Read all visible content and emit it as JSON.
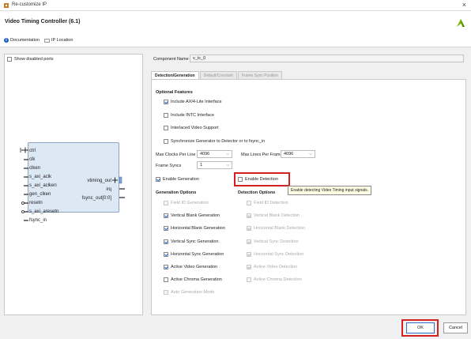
{
  "window": {
    "title": "Re-customize IP",
    "close_glyph": "×"
  },
  "header": {
    "title": "Video Timing Controller (6.1)",
    "links": [
      {
        "label": "Documentation",
        "icon": "info-icon"
      },
      {
        "label": "IP Location",
        "icon": "folder-icon"
      }
    ],
    "logo_color": "#7ab800"
  },
  "left_panel": {
    "show_disabled_ports_label": "Show disabled ports",
    "ports_left": [
      "ctrl",
      "clk",
      "clken",
      "s_axi_aclk",
      "s_axi_aclken",
      "gen_clken",
      "resetn",
      "s_axi_aresetn",
      "fsync_in"
    ],
    "ports_right": [
      "vtiming_out",
      "irq",
      "fsync_out[0:0]"
    ]
  },
  "component_name": {
    "label": "Component Name",
    "value": "v_tc_0"
  },
  "tabs": [
    "Detection/Generation",
    "Default/Constant",
    "Frame Sync Position"
  ],
  "optional_features": {
    "title": "Optional Features",
    "items": [
      {
        "label": "Include AXI4-Lite Interface",
        "checked": true
      },
      {
        "label": "Include INTC Interface",
        "checked": false
      },
      {
        "label": "Interlaced Video Support",
        "checked": false
      },
      {
        "label": "Synchronize Generator to Detector or to fsync_in",
        "checked": false
      }
    ]
  },
  "max_clocks": {
    "label": "Max Clocks Per Line",
    "value": "4096"
  },
  "max_lines": {
    "label": "Max Lines Per Frame",
    "value": "4096"
  },
  "frame_syncs": {
    "label": "Frame Syncs",
    "value": "1"
  },
  "enable_generation": {
    "label": "Enable Generation",
    "checked": true
  },
  "enable_detection": {
    "label": "Enable Detection",
    "checked": false
  },
  "tooltip": "Enable detecting Video Timing input signals.",
  "generation_options": {
    "title": "Generation Options",
    "items": [
      {
        "label": "Field ID Generation",
        "checked": false,
        "disabled": true
      },
      {
        "label": "Vertical Blank Generation",
        "checked": true,
        "disabled": false
      },
      {
        "label": "Horizontal Blank Generation",
        "checked": true,
        "disabled": false
      },
      {
        "label": "Vertical Sync Generation",
        "checked": true,
        "disabled": false
      },
      {
        "label": "Horizontal Sync Generation",
        "checked": true,
        "disabled": false
      },
      {
        "label": "Active Video Generation",
        "checked": true,
        "disabled": false
      },
      {
        "label": "Active Chroma Generation",
        "checked": false,
        "disabled": false
      },
      {
        "label": "Auto Generation Mode",
        "checked": false,
        "disabled": true
      }
    ]
  },
  "detection_options": {
    "title": "Detection Options",
    "items": [
      {
        "label": "Field ID Detection",
        "checked": false,
        "disabled": true
      },
      {
        "label": "Vertical Blank Detection",
        "checked": true,
        "disabled": true
      },
      {
        "label": "Horizontal Blank Detection",
        "checked": true,
        "disabled": true
      },
      {
        "label": "Vertical Sync Detection",
        "checked": true,
        "disabled": true
      },
      {
        "label": "Horizontal Sync Detection",
        "checked": true,
        "disabled": true
      },
      {
        "label": "Active Video Detection",
        "checked": true,
        "disabled": true
      },
      {
        "label": "Active Chroma Detection",
        "checked": false,
        "disabled": true
      }
    ]
  },
  "buttons": {
    "ok": "OK",
    "cancel": "Cancel"
  },
  "colors": {
    "highlight_red": "#d42020",
    "ip_block_fill": "#dde8f5",
    "accent_blue": "#2466c7"
  }
}
